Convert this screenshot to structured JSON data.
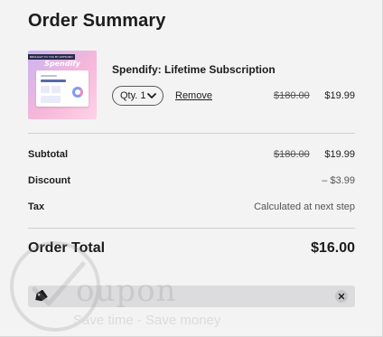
{
  "header": {
    "title": "Order Summary"
  },
  "product": {
    "name": "Spendify: Lifetime Subscription",
    "thumbnail": {
      "brand_text": "Spendify",
      "ribbon_text": "BROUGHT TO YOU BY APPSUMO"
    },
    "quantity_label": "Qty. 1",
    "remove_label": "Remove",
    "original_price": "$180.00",
    "price": "$19.99"
  },
  "summary": {
    "subtotal": {
      "label": "Subtotal",
      "original": "$180.00",
      "value": "$19.99"
    },
    "discount": {
      "label": "Discount",
      "value": "– $3.99"
    },
    "tax": {
      "label": "Tax",
      "value": "Calculated at next step"
    }
  },
  "total": {
    "label": "Order Total",
    "value": "$16.00"
  },
  "coupon": {
    "tag_icon": "tag-icon",
    "clear_icon": "close-icon",
    "value": ""
  },
  "watermark": {
    "word": "oupon",
    "tagline": "Save time - Save money"
  },
  "colors": {
    "background": "#f3f3f4",
    "text": "#1c1c1c",
    "muted": "#555555",
    "coupon_bar": "#dcdcde"
  }
}
